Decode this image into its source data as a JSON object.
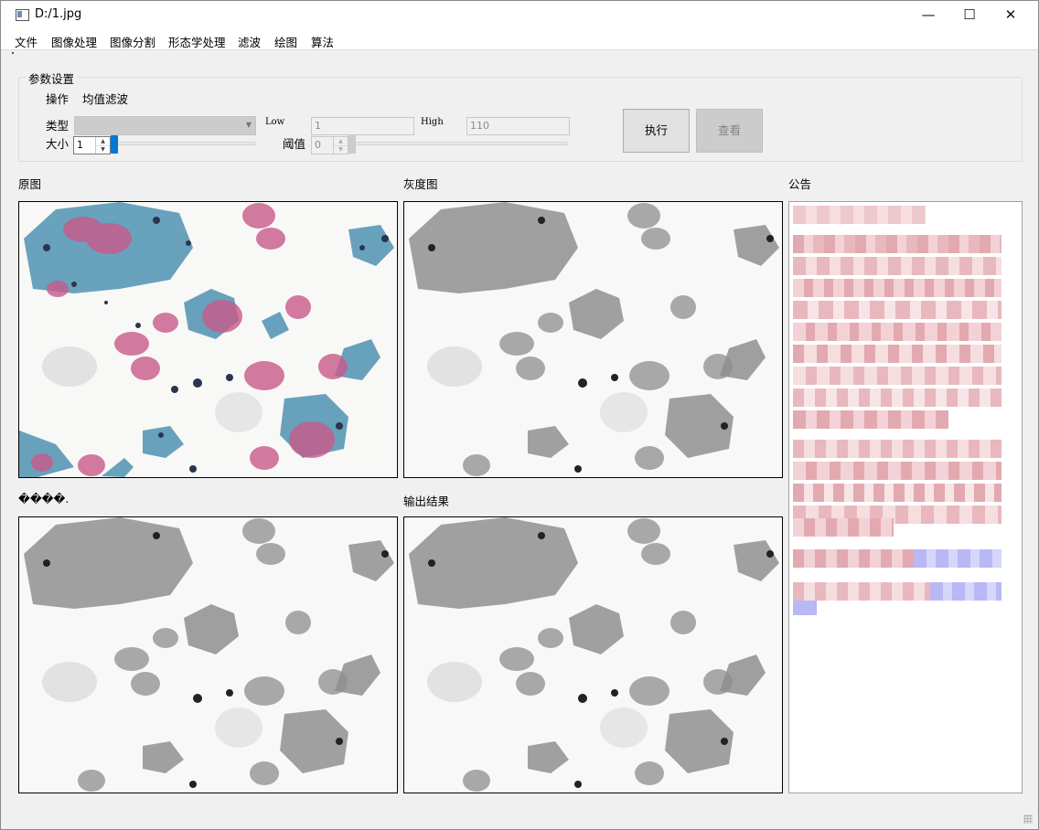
{
  "window": {
    "title": "D:/1.jpg"
  },
  "window_controls": {
    "minimize": "—",
    "maximize": "☐",
    "close": "✕"
  },
  "menu": [
    "文件",
    "图像处理",
    "图像分割",
    "形态学处理",
    "滤波",
    "绘图",
    "算法"
  ],
  "params": {
    "group_title": "参数设置",
    "operation_label": "操作",
    "operation_value": "均值滤波",
    "type_label": "类型",
    "type_value": "",
    "size_label": "大小",
    "size_value": "1",
    "low_label": "Low",
    "low_value": "1",
    "high_label": "High",
    "high_value": "110",
    "threshold_label": "阈值",
    "threshold_value": "0",
    "size_slider_level": 0,
    "threshold_slider_level": 0
  },
  "buttons": {
    "execute": "执行",
    "view": "查看"
  },
  "panels": {
    "original": "原图",
    "gray": "灰度图",
    "intermediate": "����.",
    "output": "输出结果",
    "notice": "公告"
  },
  "icons": {
    "app": "window-app-icon",
    "spin_up": "▲",
    "spin_down": "▼",
    "combo_arrow": "▼"
  },
  "colors": {
    "accent": "#0078d7",
    "stain_blue": "#4f93b3",
    "stain_pink": "#c95a8a",
    "notice_pink": "#e3a9b0",
    "notice_blue": "#b8b8f5"
  }
}
